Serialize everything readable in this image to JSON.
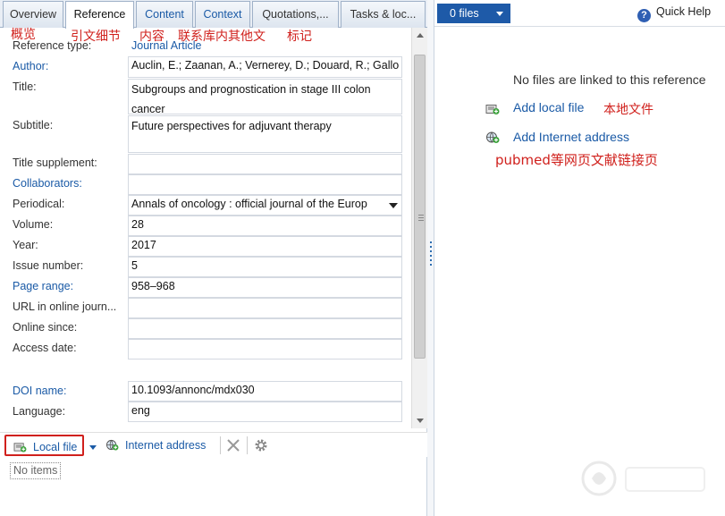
{
  "tabs": [
    {
      "label": "Overview"
    },
    {
      "label": "Reference"
    },
    {
      "label": "Content"
    },
    {
      "label": "Context"
    },
    {
      "label": "Quotations,..."
    },
    {
      "label": "Tasks & loc..."
    }
  ],
  "annotations": {
    "overview": "概览",
    "reference": "引文细节",
    "content": "内容",
    "context": "联系库内其他文",
    "quotations": "标记",
    "local_file": "本地文件",
    "internet": "pubmed等网页文献链接页"
  },
  "form": {
    "reference_type_label": "Reference type:",
    "reference_type_value": "Journal Article",
    "rows": [
      {
        "label": "Author:",
        "value": "Auclin, E.; Zaanan, A.; Vernerey, D.; Douard, R.; Gallo"
      },
      {
        "label": "Title:",
        "value": "Subgroups and prognostication in stage III colon cancer"
      },
      {
        "label": "Subtitle:",
        "value": "Future perspectives for adjuvant therapy"
      },
      {
        "label": "Title supplement:",
        "value": ""
      },
      {
        "label": "Collaborators:",
        "value": ""
      },
      {
        "label": "Periodical:",
        "value": "Annals of oncology : official journal of the Europ"
      },
      {
        "label": "Volume:",
        "value": "28"
      },
      {
        "label": "Year:",
        "value": "2017"
      },
      {
        "label": "Issue number:",
        "value": "5"
      },
      {
        "label": "Page range:",
        "value": "958–968"
      },
      {
        "label": "URL in online journ...",
        "value": ""
      },
      {
        "label": "Online since:",
        "value": ""
      },
      {
        "label": "Access date:",
        "value": ""
      },
      {
        "label": "DOI name:",
        "value": "10.1093/annonc/mdx030"
      },
      {
        "label": "Language:",
        "value": "eng"
      }
    ]
  },
  "toolbar": {
    "local_file_label": "Local file",
    "internet_address_label": "Internet address"
  },
  "attachments": {
    "empty_label": "No items"
  },
  "right": {
    "files_button": "0 files",
    "quick_help": "Quick Help",
    "no_files_message": "No files are linked to this reference",
    "add_local_file": "Add local file",
    "add_internet_address": "Add Internet address"
  },
  "colors": {
    "accent": "#1e5aa8",
    "link": "#1a5aa6",
    "annotation": "#d0201c"
  }
}
